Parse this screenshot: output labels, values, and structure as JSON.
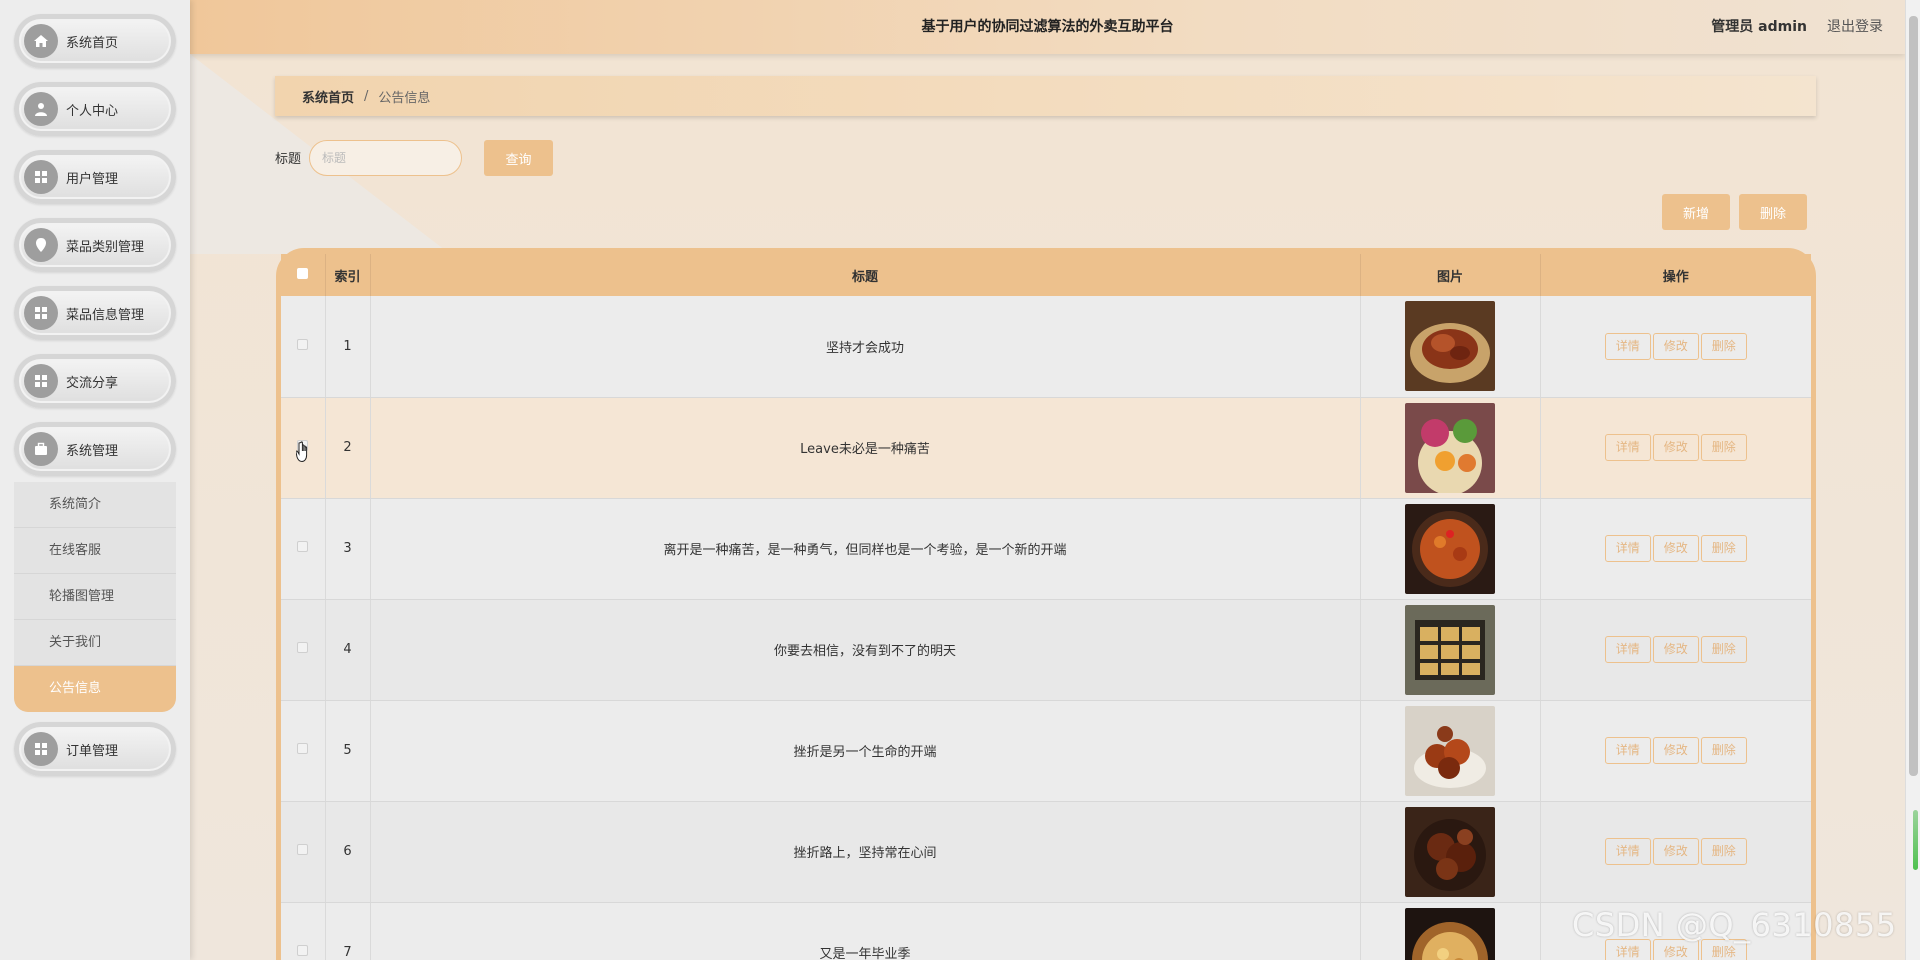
{
  "header": {
    "title": "基于用户的协同过滤算法的外卖互助平台",
    "user": "管理员 admin",
    "logout": "退出登录"
  },
  "sidebar": {
    "items": [
      {
        "label": "系统首页",
        "icon": "home-icon"
      },
      {
        "label": "个人中心",
        "icon": "user-icon"
      },
      {
        "label": "用户管理",
        "icon": "grid-icon"
      },
      {
        "label": "菜品类别管理",
        "icon": "location-icon"
      },
      {
        "label": "菜品信息管理",
        "icon": "grid-icon"
      },
      {
        "label": "交流分享",
        "icon": "grid-icon"
      },
      {
        "label": "系统管理",
        "icon": "briefcase-icon"
      }
    ],
    "submenu": [
      "系统简介",
      "在线客服",
      "轮播图管理",
      "关于我们",
      "公告信息"
    ],
    "order": {
      "label": "订单管理",
      "icon": "grid-icon"
    }
  },
  "breadcrumb": {
    "home": "系统首页",
    "separator": "/",
    "current": "公告信息"
  },
  "search": {
    "label": "标题",
    "placeholder": "标题",
    "query_button": "查询"
  },
  "actions": {
    "add": "新增",
    "delete": "删除"
  },
  "table": {
    "headers": [
      "索引",
      "标题",
      "图片",
      "操作"
    ],
    "row_actions": [
      "详情",
      "修改",
      "删除"
    ],
    "rows": [
      {
        "index": "1",
        "title": "坚持才会成功"
      },
      {
        "index": "2",
        "title": "Leave未必是一种痛苦"
      },
      {
        "index": "3",
        "title": "离开是一种痛苦，是一种勇气，但同样也是一个考验，是一个新的开端"
      },
      {
        "index": "4",
        "title": "你要去相信，没有到不了的明天"
      },
      {
        "index": "5",
        "title": "挫折是另一个生命的开端"
      },
      {
        "index": "6",
        "title": "挫折路上，坚持常在心间"
      },
      {
        "index": "7",
        "title": "又是一年毕业季"
      }
    ]
  },
  "watermark": "CSDN @Q_6310855",
  "colors": {
    "accent": "#edc18d",
    "header_start": "#f0c79a",
    "sidebar_bg": "#ededed"
  }
}
